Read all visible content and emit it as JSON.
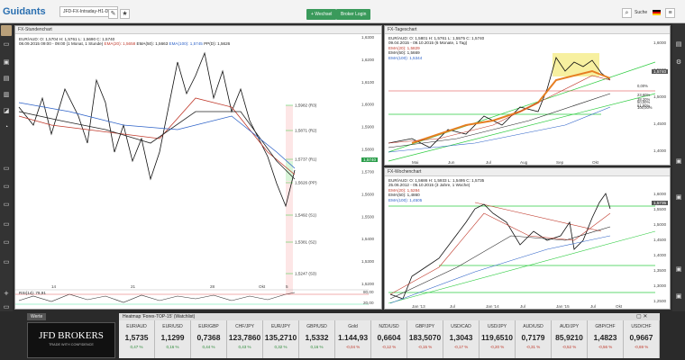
{
  "app": {
    "logo": "Guidants"
  },
  "topbar": {
    "tab_label": "JFD-FX-Intraday-H1-D-W",
    "add_workspace": "+ Wechsel",
    "broker_login": "Broker Login",
    "search": "Suche",
    "flag": "DE"
  },
  "chart1": {
    "title": "FX-Stundenchart",
    "info1": "EUR/AUD: O: 1,5704 H: 1,5761 L: 1,5690 C: 1,5740",
    "info2": "08.09.2015 09:00 - 09:00 (1 Monat, 1 Stunde)",
    "ema20": "EMA(20): 1,5658",
    "ema50": "EMA(50): 1,5663",
    "ema100": "EMA(100): 1,5745",
    "pp": "PP(D): 1,5626",
    "yticks": [
      "1,6300",
      "1,6200",
      "1,6100",
      "1,6000",
      "1,5900",
      "1,5800",
      "1,5700",
      "1,5600",
      "1,5500",
      "1,5400",
      "1,5300",
      "1,5200"
    ],
    "levels": [
      {
        "label": "1,5982 (R3)"
      },
      {
        "label": "1,5871 (R2)"
      },
      {
        "label": "1,5737 (R1)"
      },
      {
        "label": "1,5626 (PP)"
      },
      {
        "label": "1,5492 (S1)"
      },
      {
        "label": "1,5381 (S2)"
      },
      {
        "label": "1,5247 (S3)"
      }
    ],
    "price_tag": "1,5740",
    "xticks": [
      "14",
      "21",
      "28",
      "Okt",
      "5"
    ],
    "rsi_label": "RSI(14): 79,91",
    "rsi_ticks": [
      "80,00",
      "20,00"
    ]
  },
  "chart2": {
    "title": "FX-Tageschart",
    "info1": "EUR/AUD: O: 1,5801 H: 1,5761 L: 1,5575 C: 1,5740",
    "info2": "09.04.2015 - 09.10.2015 (6 Monate, 1 Tag)",
    "ema20": "EMA(20): 1,5829",
    "ema50": "EMA(50): 1,5669",
    "ema100": "EMA(100): 1,5344",
    "yticks": [
      "1,6000",
      "1,5500",
      "1,5000",
      "1,4500",
      "1,4000"
    ],
    "price_tag": "1,5740",
    "fib": [
      "0,00%",
      "23,60%",
      "38,20%",
      "50,00%",
      "61,80%",
      "100,00%"
    ],
    "xticks": [
      "Mai",
      "Jun",
      "Jul",
      "Aug",
      "Sep",
      "Okt"
    ]
  },
  "chart3": {
    "title": "FX-Wochenchart",
    "info1": "EUR/AUD: O: 1,5686 H: 1,5933 L: 1,5495 C: 1,5735",
    "info2": "25.06.2012 - 05.10.2015 (3 Jahre, 1 Woche)",
    "ema20": "EMA(20): 1,5284",
    "ema50": "EMA(50): 1,4860",
    "ema100": "EMA(100): 1,4505",
    "yticks": [
      "1,6000",
      "1,5500",
      "1,5000",
      "1,4500",
      "1,4000",
      "1,3500",
      "1,3000",
      "1,2500"
    ],
    "price_tag": "1,5735",
    "xticks": [
      "Jan '13",
      "Jul",
      "Jan '14",
      "Jul",
      "Jan '15",
      "Jul",
      "Okt"
    ]
  },
  "watchlist": {
    "tab": "Werte",
    "title": "Heatmap 'Forex-TOP-15' (Watchlist)",
    "brand": "JFD BROKERS",
    "brand_sub": "TRADE WITH CONFIDENCE",
    "items": [
      {
        "name": "EUR/AUD",
        "price": "1,5735",
        "chg": "0,47 %",
        "up": true
      },
      {
        "name": "EUR/USD",
        "price": "1,1299",
        "chg": "0,16 %",
        "up": true
      },
      {
        "name": "EUR/GBP",
        "price": "0,7368",
        "chg": "0,44 %",
        "up": true
      },
      {
        "name": "CHF/JPY",
        "price": "123,7860",
        "chg": "0,43 %",
        "up": true
      },
      {
        "name": "EUR/JPY",
        "price": "135,2710",
        "chg": "0,32 %",
        "up": true
      },
      {
        "name": "GBP/USD",
        "price": "1,5332",
        "chg": "0,16 %",
        "up": true
      },
      {
        "name": "Gold",
        "price": "1.144,93",
        "chg": "-0,04 %",
        "up": false
      },
      {
        "name": "NZD/USD",
        "price": "0,6604",
        "chg": "-0,12 %",
        "up": false
      },
      {
        "name": "GBP/JPY",
        "price": "183,5070",
        "chg": "-0,15 %",
        "up": false
      },
      {
        "name": "USD/CAD",
        "price": "1,3043",
        "chg": "-0,17 %",
        "up": false
      },
      {
        "name": "USD/JPY",
        "price": "119,6510",
        "chg": "-0,20 %",
        "up": false
      },
      {
        "name": "AUD/USD",
        "price": "0,7179",
        "chg": "-0,31 %",
        "up": false
      },
      {
        "name": "AUD/JPY",
        "price": "85,9210",
        "chg": "-0,52 %",
        "up": false
      },
      {
        "name": "GBP/CHF",
        "price": "1,4823",
        "chg": "-0,56 %",
        "up": false
      },
      {
        "name": "USD/CHF",
        "price": "0,9667",
        "chg": "-0,69 %",
        "up": false
      }
    ]
  },
  "colors": {
    "ema20": "#c0392b",
    "ema50": "#222222",
    "ema100": "#2d62c8",
    "green": "#2ecc40",
    "up": "#2e8b3a",
    "down": "#c0392b"
  }
}
